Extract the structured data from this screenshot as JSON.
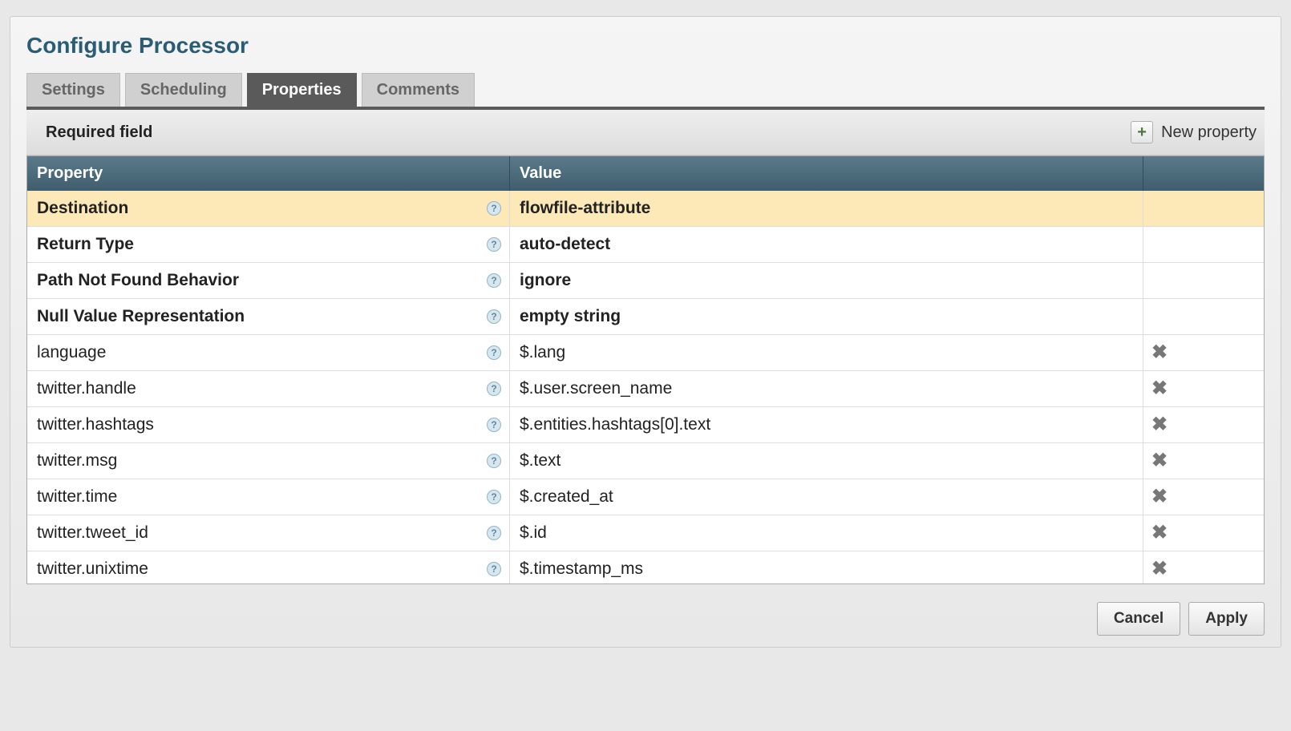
{
  "dialog": {
    "title": "Configure Processor",
    "tabs": [
      {
        "label": "Settings",
        "active": false
      },
      {
        "label": "Scheduling",
        "active": false
      },
      {
        "label": "Properties",
        "active": true
      },
      {
        "label": "Comments",
        "active": false
      }
    ],
    "requiredLabel": "Required field",
    "newPropertyLabel": "New property"
  },
  "table": {
    "headers": {
      "property": "Property",
      "value": "Value"
    },
    "rows": [
      {
        "name": "Destination",
        "value": "flowfile-attribute",
        "required": true,
        "deletable": false,
        "highlighted": true
      },
      {
        "name": "Return Type",
        "value": "auto-detect",
        "required": true,
        "deletable": false,
        "highlighted": false
      },
      {
        "name": "Path Not Found Behavior",
        "value": "ignore",
        "required": true,
        "deletable": false,
        "highlighted": false
      },
      {
        "name": "Null Value Representation",
        "value": "empty string",
        "required": true,
        "deletable": false,
        "highlighted": false
      },
      {
        "name": "language",
        "value": "$.lang",
        "required": false,
        "deletable": true,
        "highlighted": false
      },
      {
        "name": "twitter.handle",
        "value": "$.user.screen_name",
        "required": false,
        "deletable": true,
        "highlighted": false
      },
      {
        "name": "twitter.hashtags",
        "value": "$.entities.hashtags[0].text",
        "required": false,
        "deletable": true,
        "highlighted": false
      },
      {
        "name": "twitter.msg",
        "value": "$.text",
        "required": false,
        "deletable": true,
        "highlighted": false
      },
      {
        "name": "twitter.time",
        "value": "$.created_at",
        "required": false,
        "deletable": true,
        "highlighted": false
      },
      {
        "name": "twitter.tweet_id",
        "value": "$.id",
        "required": false,
        "deletable": true,
        "highlighted": false
      },
      {
        "name": "twitter.unixtime",
        "value": "$.timestamp_ms",
        "required": false,
        "deletable": true,
        "highlighted": false
      }
    ]
  },
  "footer": {
    "cancel": "Cancel",
    "apply": "Apply"
  }
}
